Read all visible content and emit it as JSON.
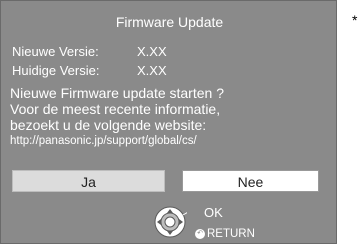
{
  "dialog": {
    "title": "Firmware Update",
    "new_version_label": "Nieuwe Versie:",
    "new_version_value": "X.XX",
    "current_version_label": "Huidige Versie:",
    "current_version_value": "X.XX",
    "message_line1": "Nieuwe Firmware update starten ?",
    "message_line2": "Voor de meest recente informatie,",
    "message_line3": "bezoekt u de volgende website:",
    "url": "http://panasonic.jp/support/global/cs/"
  },
  "buttons": {
    "yes": "Ja",
    "no": "Nee"
  },
  "footer": {
    "ok": "OK",
    "return": "RETURN",
    "dpad_icon": "dpad-icon",
    "return_icon": "return-icon"
  },
  "side_mark": "*",
  "colors": {
    "screen_bg": "#8a8a8a",
    "yes_button": "#dcdcdc",
    "no_button": "#ffffff"
  }
}
